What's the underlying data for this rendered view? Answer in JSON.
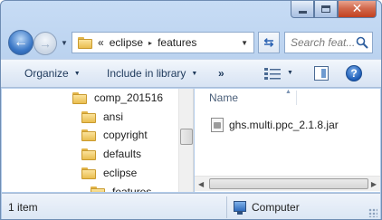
{
  "window": {
    "caption_buttons": {
      "minimize": "minimize",
      "maximize": "maximize",
      "close": "✕"
    }
  },
  "address_bar": {
    "prefix": "«",
    "segments": [
      "eclipse",
      "features"
    ],
    "separator": "▸"
  },
  "search": {
    "placeholder": "Search feat..."
  },
  "toolbar": {
    "organize": "Organize",
    "include_in_library": "Include in library",
    "more": "»",
    "help": "?"
  },
  "nav_pane": {
    "items": [
      {
        "label": "comp_201516"
      },
      {
        "label": "ansi"
      },
      {
        "label": "copyright"
      },
      {
        "label": "defaults"
      },
      {
        "label": "eclipse"
      },
      {
        "label": "features"
      }
    ]
  },
  "content": {
    "column_header": "Name",
    "files": [
      {
        "name": "ghs.multi.ppc_2.1.8.jar",
        "icon": "jar-file-icon"
      }
    ]
  },
  "status_bar": {
    "item_count": "1 item",
    "location": "Computer"
  },
  "colors": {
    "frame": "#b9d1ee",
    "close_button": "#c2411f",
    "command_text": "#1e395b",
    "folder": "#e9bd4f"
  }
}
